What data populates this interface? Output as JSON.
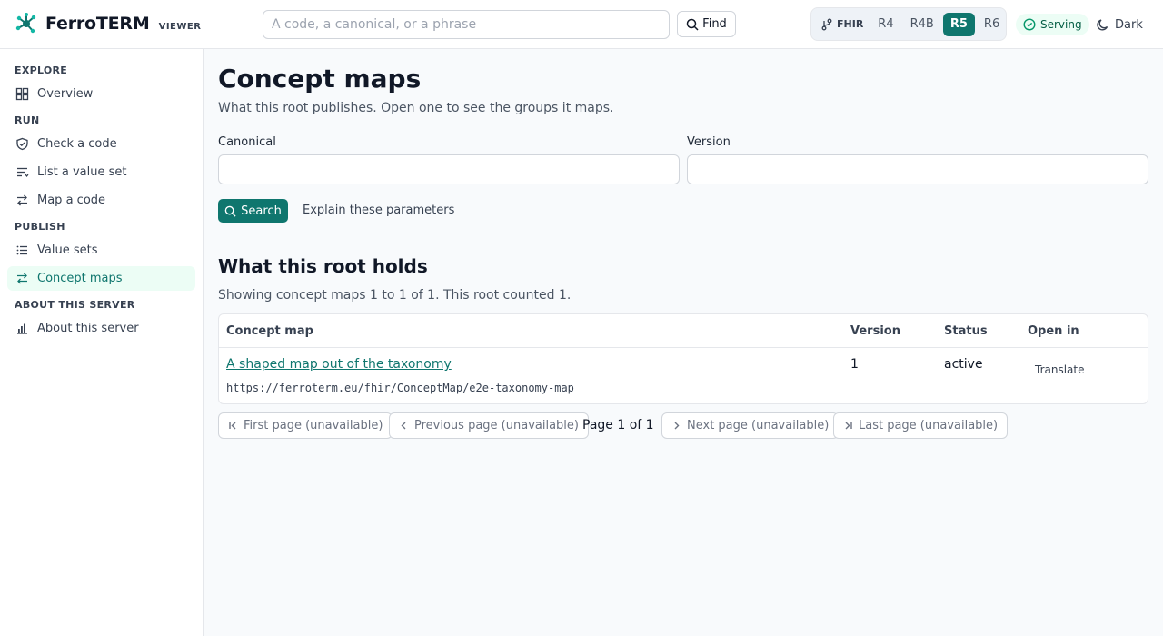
{
  "app": {
    "name": "FerroTERM",
    "subtitle": "VIEWER"
  },
  "header": {
    "search_placeholder": "A code, a canonical, or a phrase",
    "find_label": "Find",
    "fhir_label": "FHIR",
    "versions": [
      "R4",
      "R4B",
      "R5",
      "R6"
    ],
    "active_version": "R5",
    "status": "Serving",
    "theme_label": "Dark"
  },
  "sidebar": {
    "sections": [
      {
        "heading": "EXPLORE",
        "items": [
          {
            "label": "Overview",
            "icon": "grid-icon"
          }
        ]
      },
      {
        "heading": "RUN",
        "items": [
          {
            "label": "Check a code",
            "icon": "shield-check-icon"
          },
          {
            "label": "List a value set",
            "icon": "list-filter-icon"
          },
          {
            "label": "Map a code",
            "icon": "arrows-swap-icon"
          }
        ]
      },
      {
        "heading": "PUBLISH",
        "items": [
          {
            "label": "Value sets",
            "icon": "list-icon"
          },
          {
            "label": "Concept maps",
            "icon": "arrows-swap-icon",
            "active": true
          }
        ]
      },
      {
        "heading": "ABOUT THIS SERVER",
        "items": [
          {
            "label": "About this server",
            "icon": "bar-chart-icon"
          }
        ]
      }
    ]
  },
  "main": {
    "title": "Concept maps",
    "subtitle": "What this root publishes. Open one to see the groups it maps.",
    "form": {
      "canonical_label": "Canonical",
      "canonical_value": "",
      "version_label": "Version",
      "version_value": "",
      "search_label": "Search",
      "explain_label": "Explain these parameters"
    },
    "results_title": "What this root holds",
    "showing": "Showing concept maps 1 to 1 of 1. This root counted 1.",
    "table": {
      "columns": [
        "Concept map",
        "Version",
        "Status",
        "Open in"
      ],
      "rows": [
        {
          "name": "A shaped map out of the taxonomy",
          "url": "https://ferroterm.eu/fhir/ConceptMap/e2e-taxonomy-map",
          "version": "1",
          "status": "active",
          "open_in": "Translate"
        }
      ]
    },
    "pager": {
      "first": "First page (unavailable)",
      "previous": "Previous page (unavailable)",
      "page_text": "Page 1 of 1",
      "next": "Next page (unavailable)",
      "last": "Last page (unavailable)"
    }
  },
  "colors": {
    "accent": "#0f766e",
    "accent_soft": "#ecfdf5",
    "border": "#e5e7eb",
    "background": "#f8fafc"
  }
}
